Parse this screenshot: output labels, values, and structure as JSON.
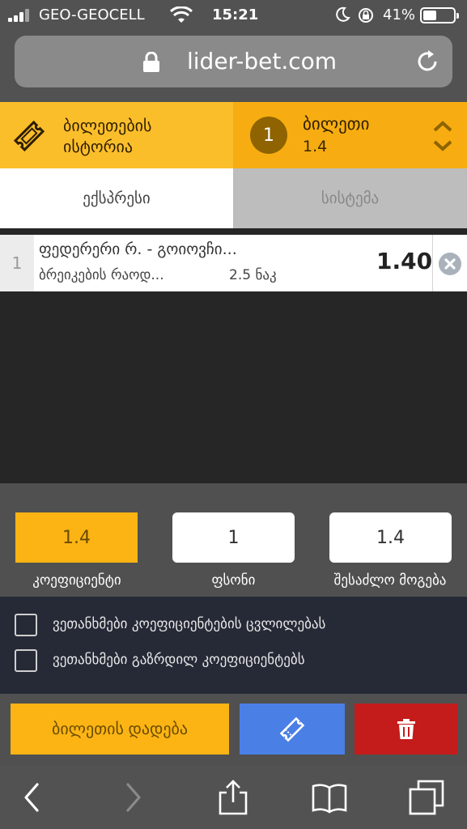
{
  "status_bar": {
    "carrier": "GEO-GEOCELL",
    "time": "15:21",
    "battery": "41%"
  },
  "browser": {
    "url": "lider-bet.com"
  },
  "header": {
    "history_label": "ბილეთების\nისტორია",
    "ticket_count": "1",
    "ticket_title": "ბილეთი",
    "ticket_odds": "1.4"
  },
  "tabs": [
    {
      "label": "ექსპრესი",
      "active": true
    },
    {
      "label": "სისტემა",
      "active": false
    }
  ],
  "bet": {
    "index": "1",
    "event": "ფედერერი რ. - გოიოვჩი...",
    "market": "ბრეიკების რაოდ...",
    "line": "2.5 ნაკ",
    "odds": "1.40"
  },
  "stake": {
    "odds_value": "1.4",
    "odds_label": "კოეფიციენტი",
    "stake_value": "1",
    "stake_label": "ფსონი",
    "win_value": "1.4",
    "win_label": "შესაძლო მოგება"
  },
  "options": [
    {
      "label": "ვეთანხმები კოეფიციენტების ცვლილებას",
      "checked": false
    },
    {
      "label": "ვეთანხმები გაზრდილ კოეფიციენტებს",
      "checked": false
    }
  ],
  "actions": {
    "place_bet_label": "ბილეთის დადება"
  },
  "colors": {
    "accent": "#fbb414",
    "share": "#4a7fe6",
    "delete": "#c41b1b"
  }
}
